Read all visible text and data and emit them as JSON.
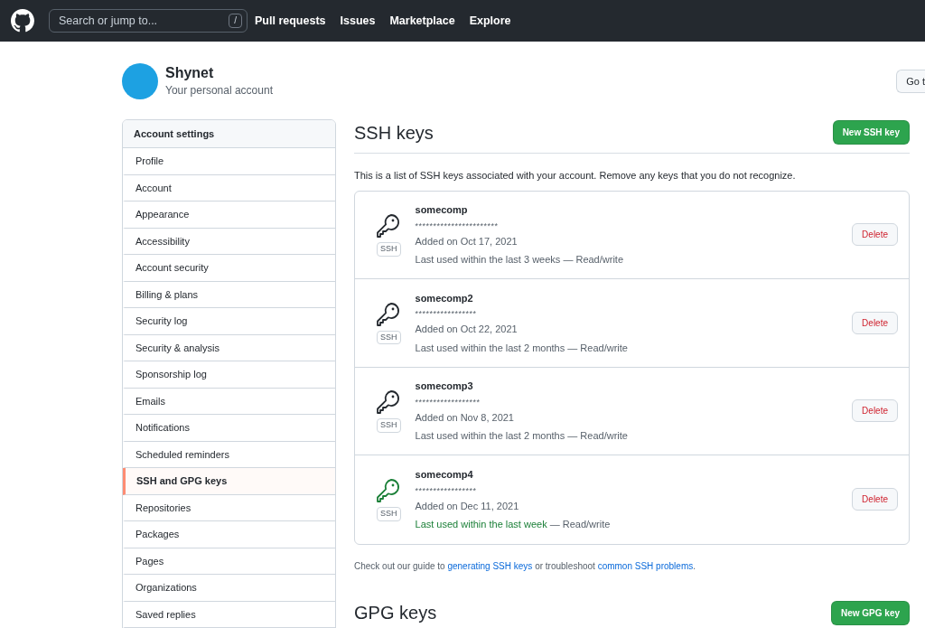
{
  "header": {
    "search_placeholder": "Search or jump to...",
    "search_shortcut": "/",
    "nav": [
      "Pull requests",
      "Issues",
      "Marketplace",
      "Explore"
    ]
  },
  "account": {
    "name": "Shynet",
    "subtitle": "Your personal account",
    "go_button": "Go t"
  },
  "sidebar": {
    "title": "Account settings",
    "items": [
      {
        "label": "Profile",
        "selected": false
      },
      {
        "label": "Account",
        "selected": false
      },
      {
        "label": "Appearance",
        "selected": false
      },
      {
        "label": "Accessibility",
        "selected": false
      },
      {
        "label": "Account security",
        "selected": false
      },
      {
        "label": "Billing & plans",
        "selected": false
      },
      {
        "label": "Security log",
        "selected": false
      },
      {
        "label": "Security & analysis",
        "selected": false
      },
      {
        "label": "Sponsorship log",
        "selected": false
      },
      {
        "label": "Emails",
        "selected": false
      },
      {
        "label": "Notifications",
        "selected": false
      },
      {
        "label": "Scheduled reminders",
        "selected": false
      },
      {
        "label": "SSH and GPG keys",
        "selected": true
      },
      {
        "label": "Repositories",
        "selected": false
      },
      {
        "label": "Packages",
        "selected": false
      },
      {
        "label": "Pages",
        "selected": false
      },
      {
        "label": "Organizations",
        "selected": false
      },
      {
        "label": "Saved replies",
        "selected": false
      }
    ]
  },
  "ssh": {
    "title": "SSH keys",
    "new_button": "New SSH key",
    "description": "This is a list of SSH keys associated with your account. Remove any keys that you do not recognize.",
    "keys": [
      {
        "name": "somecomp",
        "fingerprint": "***********************",
        "added": "Added on Oct 17, 2021",
        "last_used": "Last used within the last 3 weeks",
        "access": " — Read/write",
        "badge": "SSH",
        "recent": false,
        "delete": "Delete"
      },
      {
        "name": "somecomp2",
        "fingerprint": "*****************",
        "added": "Added on Oct 22, 2021",
        "last_used": "Last used within the last 2 months",
        "access": " — Read/write",
        "badge": "SSH",
        "recent": false,
        "delete": "Delete"
      },
      {
        "name": "somecomp3",
        "fingerprint": "******************",
        "added": "Added on Nov 8, 2021",
        "last_used": "Last used within the last 2 months",
        "access": " — Read/write",
        "badge": "SSH",
        "recent": false,
        "delete": "Delete"
      },
      {
        "name": "somecomp4",
        "fingerprint": "*****************",
        "added": "Added on Dec 11, 2021",
        "last_used": "Last used within the last week",
        "access": " — Read/write",
        "badge": "SSH",
        "recent": true,
        "delete": "Delete"
      }
    ],
    "guide": {
      "before": "Check out our guide to ",
      "link1": "generating SSH keys",
      "middle": " or troubleshoot ",
      "link2": "common SSH problems",
      "after": "."
    }
  },
  "gpg": {
    "title": "GPG keys",
    "new_button": "New GPG key"
  }
}
